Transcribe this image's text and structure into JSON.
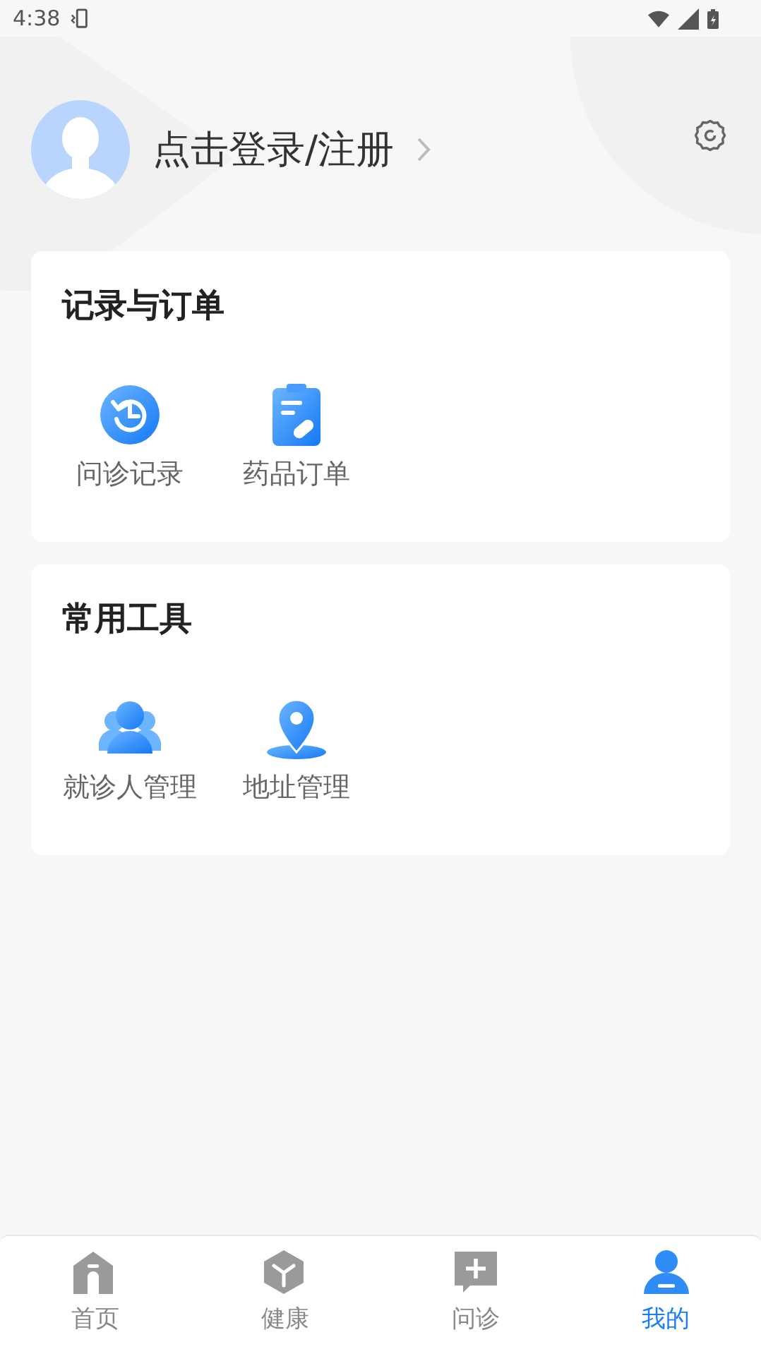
{
  "status_bar": {
    "time": "4:38"
  },
  "profile": {
    "login_text": "点击登录/注册"
  },
  "sections": [
    {
      "title": "记录与订单",
      "items": [
        {
          "kind": "history",
          "label": "问诊记录"
        },
        {
          "kind": "clipboard",
          "label": "药品订单"
        }
      ]
    },
    {
      "title": "常用工具",
      "items": [
        {
          "kind": "people",
          "label": "就诊人管理"
        },
        {
          "kind": "location",
          "label": "地址管理"
        }
      ]
    }
  ],
  "tabs": [
    {
      "kind": "home",
      "label": "首页",
      "selected": false
    },
    {
      "kind": "cube",
      "label": "健康",
      "selected": false
    },
    {
      "kind": "chat",
      "label": "问诊",
      "selected": false
    },
    {
      "kind": "person",
      "label": "我的",
      "selected": true
    }
  ]
}
